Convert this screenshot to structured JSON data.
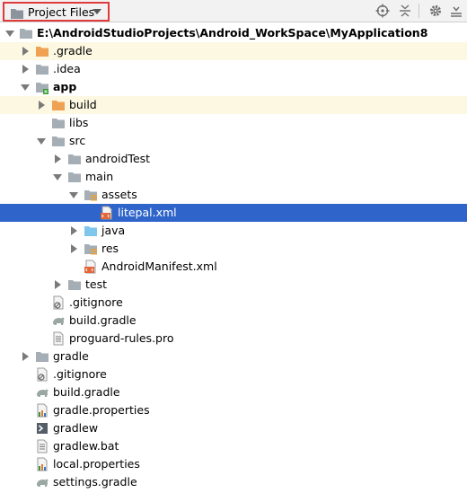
{
  "toolbar": {
    "view_label": "Project Files",
    "icons": [
      "folder-icon",
      "dropdown-caret-icon",
      "locate-target-icon",
      "collapse-all-icon",
      "gear-icon",
      "hide-panel-icon"
    ]
  },
  "tree": {
    "root": "E:\\AndroidStudioProjects\\Android_WorkSpace\\MyApplication8",
    "gradle_hidden": ".gradle",
    "idea": ".idea",
    "app": "app",
    "build": "build",
    "libs": "libs",
    "src": "src",
    "androidTest": "androidTest",
    "main": "main",
    "assets": "assets",
    "litepal": "litepal.xml",
    "java": "java",
    "res": "res",
    "manifest": "AndroidManifest.xml",
    "test": "test",
    "app_gitignore": ".gitignore",
    "app_build_gradle": "build.gradle",
    "proguard": "proguard-rules.pro",
    "gradle_dir": "gradle",
    "root_gitignore": ".gitignore",
    "root_build_gradle": "build.gradle",
    "gradle_properties": "gradle.properties",
    "gradlew": "gradlew",
    "gradlew_bat": "gradlew.bat",
    "local_properties": "local.properties",
    "settings_gradle": "settings.gradle"
  },
  "colors": {
    "selection": "#2f65ca",
    "excluded_highlight": "#fdf8e1",
    "excluded_folder": "#f0a254",
    "folder": "#a5adb5",
    "source_folder": "#7ec6ec",
    "view_selector_border": "#e03a3a"
  }
}
